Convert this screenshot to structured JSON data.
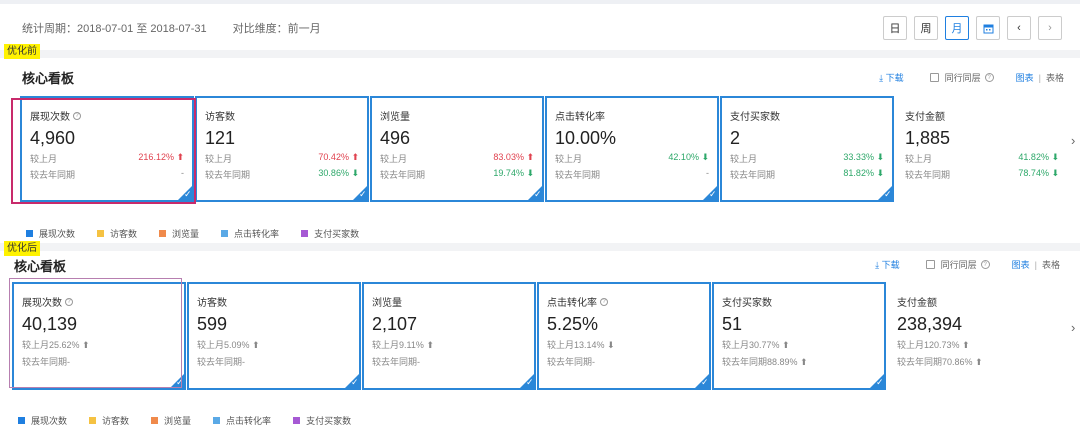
{
  "header": {
    "period_label": "统计周期：2018-07-01 至 2018-07-31",
    "compare_label": "对比维度：前一月",
    "buttons": [
      "日",
      "周",
      "月"
    ],
    "calendar_icon": "calendar-icon",
    "prev_icon": "chevron-left-icon",
    "next_icon": "chevron-right-icon"
  },
  "tags": {
    "before": "优化前",
    "after": "优化后"
  },
  "before": {
    "title": "核心看板",
    "tools": {
      "download": "下载",
      "peer": "同行同层",
      "chart": "图表",
      "sep": "|",
      "table": "表格"
    },
    "cards": [
      {
        "title": "展现次数",
        "help": true,
        "value": "4,960",
        "r1_label": "较上月",
        "r1_val": "216.12% ⬆",
        "r1_dir": "up",
        "r2_label": "较去年同期",
        "r2_val": "-",
        "r2_dir": ""
      },
      {
        "title": "访客数",
        "help": false,
        "value": "121",
        "r1_label": "较上月",
        "r1_val": "70.42% ⬆",
        "r1_dir": "up",
        "r2_label": "较去年同期",
        "r2_val": "30.86% ⬇",
        "r2_dir": "down"
      },
      {
        "title": "浏览量",
        "help": false,
        "value": "496",
        "r1_label": "较上月",
        "r1_val": "83.03% ⬆",
        "r1_dir": "up",
        "r2_label": "较去年同期",
        "r2_val": "19.74% ⬇",
        "r2_dir": "down"
      },
      {
        "title": "点击转化率",
        "help": false,
        "value": "10.00%",
        "r1_label": "较上月",
        "r1_val": "42.10% ⬇",
        "r1_dir": "down",
        "r2_label": "较去年同期",
        "r2_val": "-",
        "r2_dir": ""
      },
      {
        "title": "支付买家数",
        "help": false,
        "value": "2",
        "r1_label": "较上月",
        "r1_val": "33.33% ⬇",
        "r1_dir": "down",
        "r2_label": "较去年同期",
        "r2_val": "81.82% ⬇",
        "r2_dir": "down"
      },
      {
        "title": "支付金额",
        "help": false,
        "value": "1,885",
        "r1_label": "较上月",
        "r1_val": "41.82% ⬇",
        "r1_dir": "down",
        "r2_label": "较去年同期",
        "r2_val": "78.74% ⬇",
        "r2_dir": "down"
      }
    ],
    "legend": [
      {
        "label": "展现次数",
        "color": "#1f7fe0"
      },
      {
        "label": "访客数",
        "color": "#f5c242"
      },
      {
        "label": "浏览量",
        "color": "#f08a4b"
      },
      {
        "label": "点击转化率",
        "color": "#5aa9e6"
      },
      {
        "label": "支付买家数",
        "color": "#a659d4"
      }
    ]
  },
  "after": {
    "title": "核心看板",
    "tools": {
      "download": "下载",
      "peer": "同行同层",
      "chart": "图表",
      "sep": "|",
      "table": "表格"
    },
    "cards": [
      {
        "title": "展现次数",
        "help": true,
        "value": "40,139",
        "r1_text": "较上月25.62% ⬆",
        "r2_text": "较去年同期-"
      },
      {
        "title": "访客数",
        "help": false,
        "value": "599",
        "r1_text": "较上月5.09% ⬆",
        "r2_text": "较去年同期-"
      },
      {
        "title": "浏览量",
        "help": false,
        "value": "2,107",
        "r1_text": "较上月9.11% ⬆",
        "r2_text": "较去年同期-"
      },
      {
        "title": "点击转化率",
        "help": true,
        "value": "5.25%",
        "r1_text": "较上月13.14% ⬇",
        "r2_text": "较去年同期-"
      },
      {
        "title": "支付买家数",
        "help": false,
        "value": "51",
        "r1_text": "较上月30.77% ⬆",
        "r2_text": "较去年同期88.89% ⬆"
      },
      {
        "title": "支付金额",
        "help": false,
        "value": "238,394",
        "r1_text": "较上月120.73% ⬆",
        "r2_text": "较去年同期70.86% ⬆"
      }
    ],
    "legend": [
      {
        "label": "展现次数",
        "color": "#1f7fe0"
      },
      {
        "label": "访客数",
        "color": "#f5c242"
      },
      {
        "label": "浏览量",
        "color": "#f08a4b"
      },
      {
        "label": "点击转化率",
        "color": "#5aa9e6"
      },
      {
        "label": "支付买家数",
        "color": "#a659d4"
      }
    ]
  }
}
